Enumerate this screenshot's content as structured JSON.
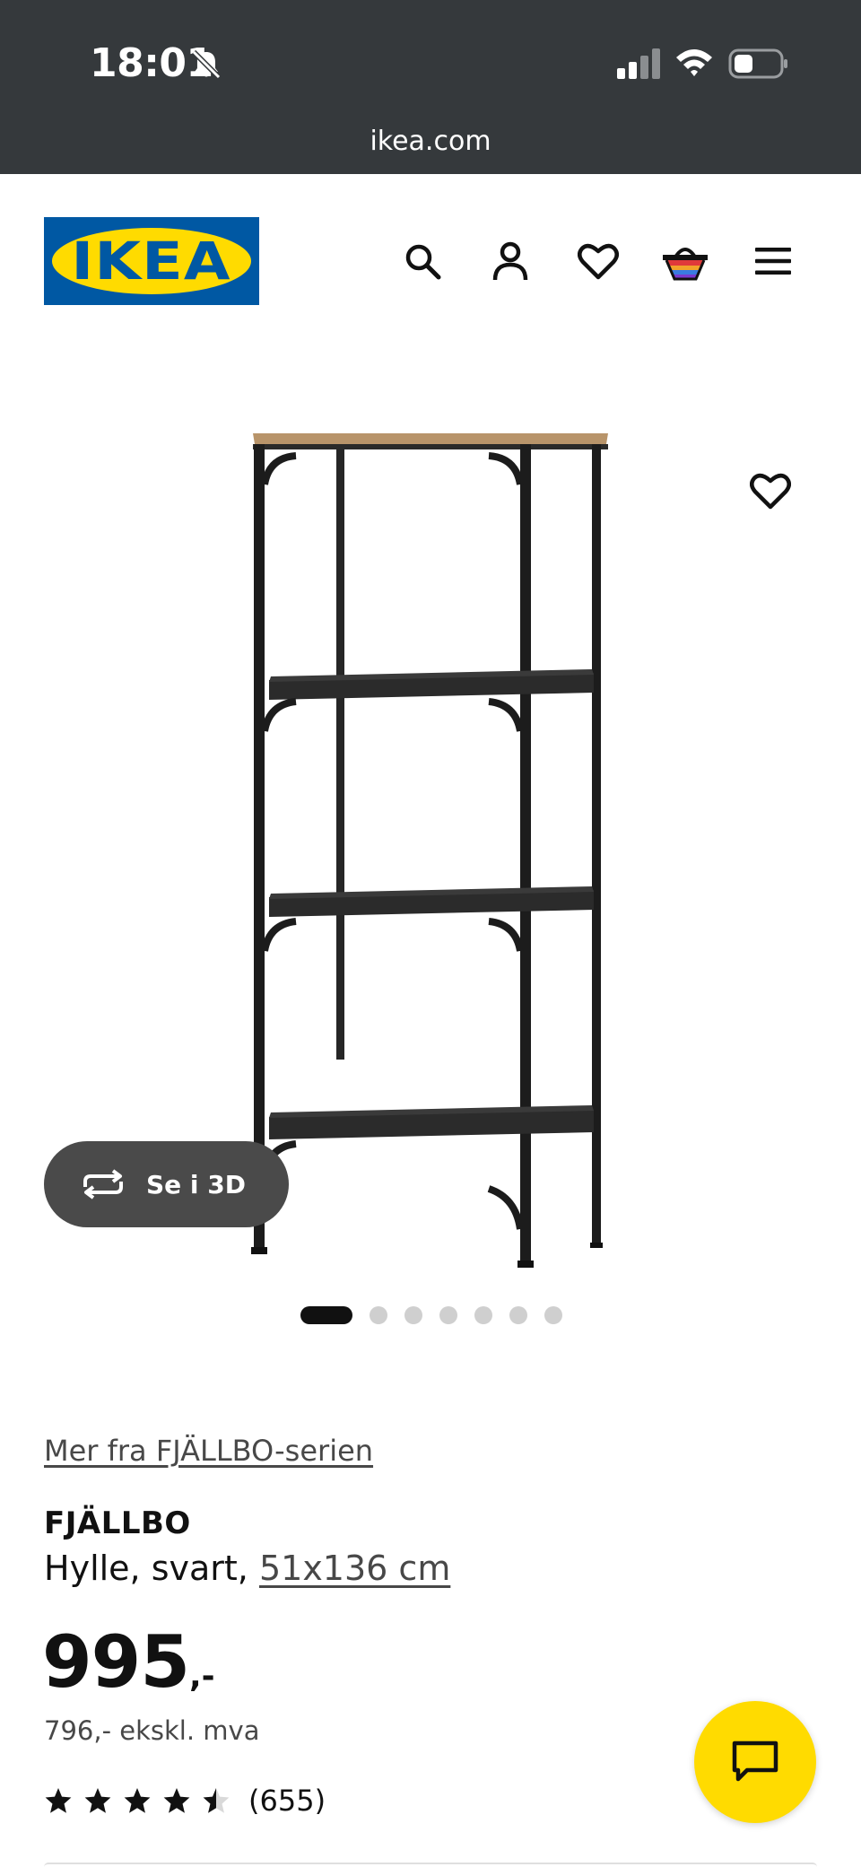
{
  "status_bar": {
    "time": "18:01",
    "url": "ikea.com"
  },
  "header": {
    "logo_text": "IKEA",
    "brand_colors": {
      "blue": "#0058a3",
      "yellow": "#ffdb00"
    },
    "icons": [
      "search-icon",
      "account-icon",
      "heart-icon",
      "basket-icon",
      "menu-icon"
    ]
  },
  "gallery": {
    "view_3d_label": "Se i 3D",
    "image_count": 7,
    "active_index": 0
  },
  "product": {
    "series_link": "Mer fra FJÄLLBO-serien",
    "name": "FJÄLLBO",
    "description": "Hylle, svart, ",
    "size": "51x136 cm",
    "price": "995",
    "price_suffix": ",-",
    "price_excl_vat": "796,- ekskl. mva",
    "rating_value": 4.5,
    "rating_count": "(655)"
  },
  "chat": {
    "icon": "chat-icon",
    "accent": "#ffdb00"
  }
}
